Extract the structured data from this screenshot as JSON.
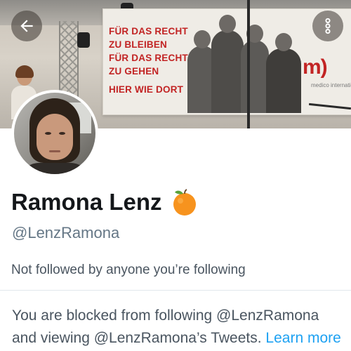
{
  "banner": {
    "placard_lines": [
      "FÜR DAS RECHT",
      "ZU BLEIBEN",
      "FÜR DAS RECHT",
      "ZU GEHEN",
      "HIER WIE DORT"
    ],
    "logo_text": "m)",
    "logo_subtext": "medico international"
  },
  "header": {
    "back_icon": "arrow-left-icon",
    "more_icon": "more-vertical-icon"
  },
  "profile": {
    "display_name": "Ramona Lenz",
    "name_emoji": "orange-icon",
    "handle": "@LenzRamona",
    "follow_context": "Not followed by anyone you’re following"
  },
  "blocked": {
    "line1": "You are blocked from following @LenzRamona",
    "line2_prefix": "and viewing @LenzRamona’s Tweets. ",
    "learn_more": "Learn more"
  },
  "colors": {
    "accent": "#1da1f2",
    "text_primary": "#14171a",
    "text_secondary": "#657786",
    "placard_red": "#c22424",
    "emoji_orange": "#f7931e"
  }
}
